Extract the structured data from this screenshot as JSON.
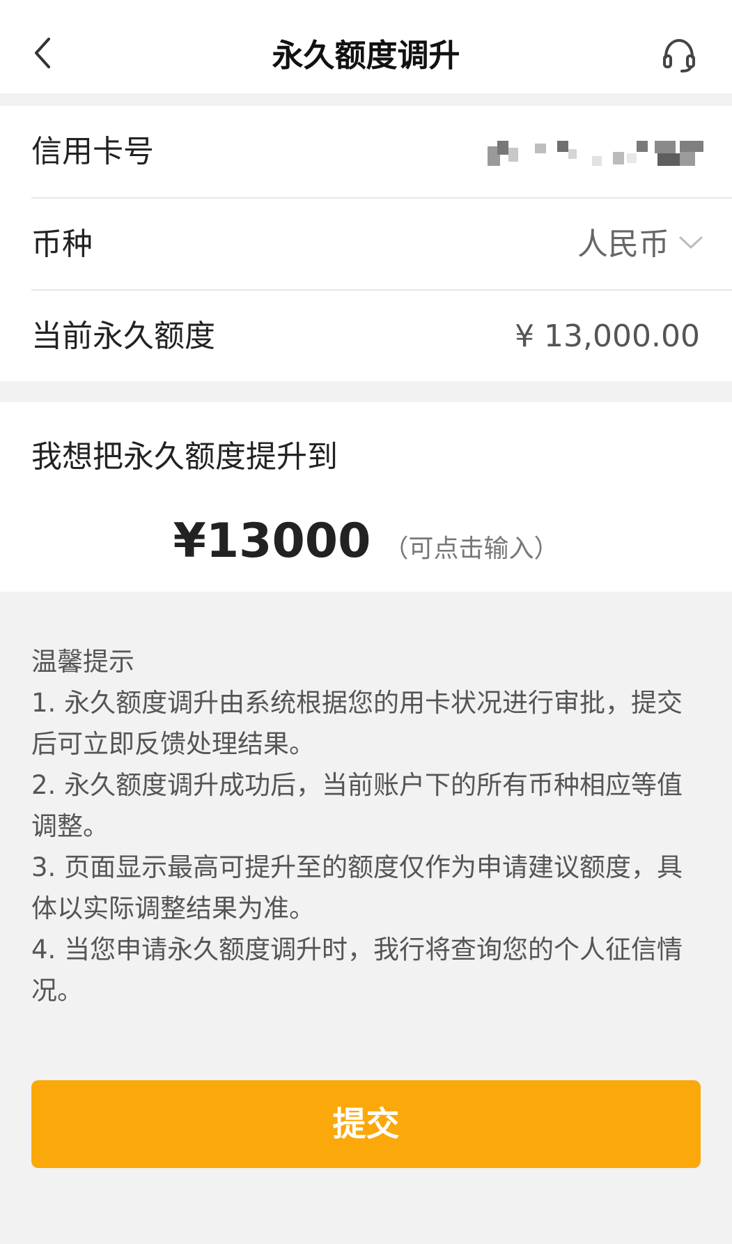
{
  "header": {
    "title": "永久额度调升",
    "back_icon": "chevron-left-icon",
    "service_icon": "headset-icon"
  },
  "card_info": {
    "card_number_label": "信用卡号",
    "currency_label": "币种",
    "currency_value": "人民币",
    "current_limit_label": "当前永久额度",
    "current_limit_value": "¥ 13,000.00"
  },
  "raise": {
    "label": "我想把永久额度提升到",
    "amount": "¥13000",
    "hint": "（可点击输入）"
  },
  "tips": {
    "title": "温馨提示",
    "items": [
      "1. 永久额度调升由系统根据您的用卡状况进行审批，提交后可立即反馈处理结果。",
      "2. 永久额度调升成功后，当前账户下的所有币种相应等值调整。",
      "3. 页面显示最高可提升至的额度仅作为申请建议额度，具体以实际调整结果为准。",
      "4. 当您申请永久额度调升时，我行将查询您的个人征信情况。"
    ]
  },
  "submit": {
    "label": "提交"
  },
  "colors": {
    "accent": "#fba80b",
    "background": "#f2f2f2"
  }
}
